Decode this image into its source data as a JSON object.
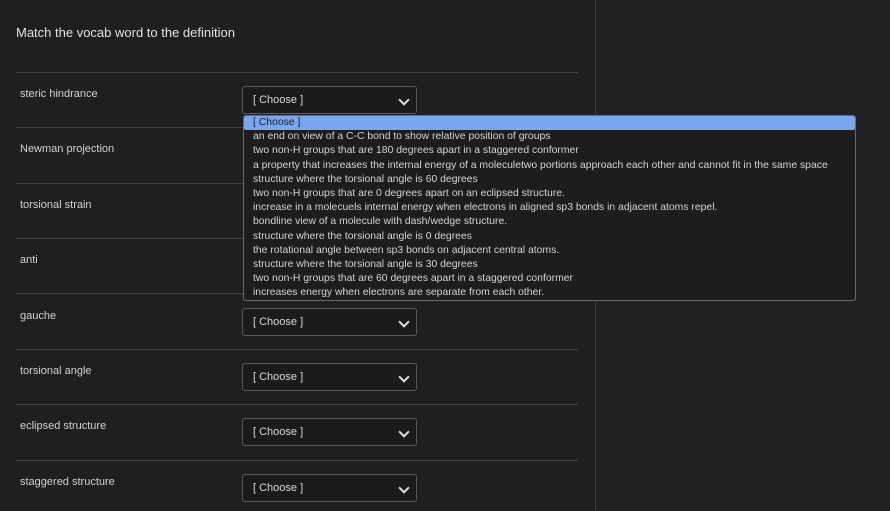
{
  "prompt": "Match the vocab word to the definition",
  "rows": [
    {
      "term": "steric hindrance",
      "value": "[ Choose ]"
    },
    {
      "term": "Newman projection",
      "value": "[ Choose ]"
    },
    {
      "term": "torsional strain",
      "value": "[ Choose ]"
    },
    {
      "term": "anti",
      "value": "[ Choose ]"
    },
    {
      "term": "gauche",
      "value": "[ Choose ]"
    },
    {
      "term": "torsional angle",
      "value": "[ Choose ]"
    },
    {
      "term": "eclipsed structure",
      "value": "[ Choose ]"
    },
    {
      "term": "staggered structure",
      "value": "[ Choose ]"
    }
  ],
  "dropdown_options": [
    "[ Choose ]",
    "an end on view of a C-C bond to show relative position of groups",
    "two non-H groups that are 180 degrees apart in a staggered conformer",
    "a property that increases the internal energy of a moleculetwo portions approach each other and cannot fit in the same space",
    "structure where the torsional angle is 60 degrees",
    "two non-H groups that are 0 degrees apart on an eclipsed structure.",
    "increase in a molecuels internal energy when electrons in aligned sp3 bonds in adjacent atoms repel.",
    "bondline view of a molecule with dash/wedge structure.",
    "structure where the torsional angle is 0 degrees",
    "the rotational angle between sp3 bonds on adjacent central atoms.",
    "structure where the torsional angle is 30 degrees",
    "two non-H groups that are 60 degrees apart in a staggered conformer",
    "increases energy when electrons are separate from each other."
  ],
  "highlighted_option": "[ Choose ]",
  "colors": {
    "background": "#1f1f21",
    "highlight": "#7aa8f0"
  }
}
